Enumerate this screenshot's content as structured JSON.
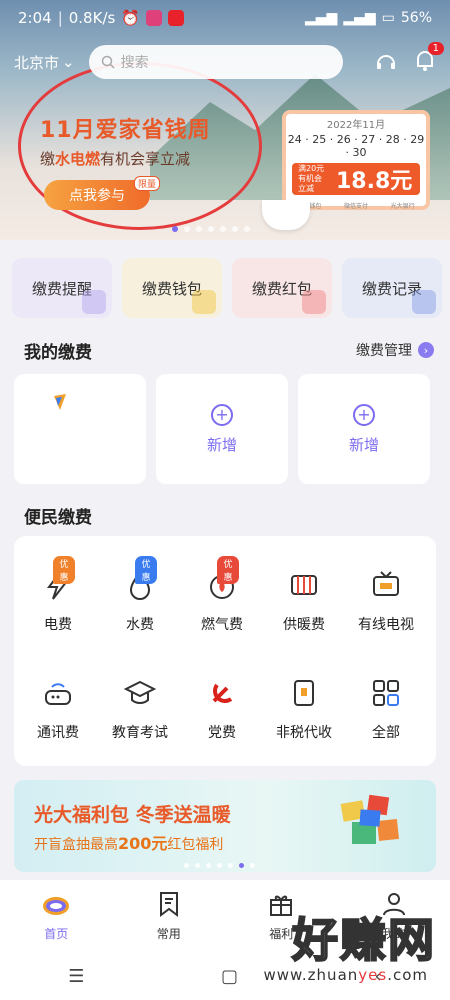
{
  "status": {
    "time": "2:04",
    "speed": "0.8K/s",
    "battery": "56%"
  },
  "header": {
    "city": "北京市",
    "search_placeholder": "搜索",
    "notif_count": "1"
  },
  "hero": {
    "title": "11月爱家省钱周",
    "sub_prefix": "缴",
    "sub_hl": "水电燃",
    "sub_suffix": "有机会享立减",
    "join": "点我参与",
    "limited": "限量",
    "card_date": "2022年11月",
    "card_days": "24 · 25 · 26 · 27 · 28 · 29 · 30",
    "card_small": "满20元 有机会 立减",
    "card_amount": "18.8元",
    "card_foot": [
      "缴费钱包",
      "微信支付",
      "光大银行"
    ]
  },
  "quick": [
    {
      "label": "缴费提醒",
      "bg": "#ece8f7",
      "deco": "#b6a8f0"
    },
    {
      "label": "缴费钱包",
      "bg": "#f6f0dc",
      "deco": "#f2c84a"
    },
    {
      "label": "缴费红包",
      "bg": "#f8e5e5",
      "deco": "#f08888"
    },
    {
      "label": "缴费记录",
      "bg": "#e6eaf6",
      "deco": "#8aa0e6"
    }
  ],
  "my_pay": {
    "title": "我的缴费",
    "manage": "缴费管理",
    "add": "新增"
  },
  "convenience": {
    "title": "便民缴费",
    "items": [
      {
        "label": "电费",
        "tag": "优惠",
        "tagc": "#f0802a"
      },
      {
        "label": "水费",
        "tag": "优惠",
        "tagc": "#3a7cf0"
      },
      {
        "label": "燃气费",
        "tag": "优惠",
        "tagc": "#e84a3a"
      },
      {
        "label": "供暖费",
        "tag": "",
        "tagc": ""
      },
      {
        "label": "有线电视",
        "tag": "",
        "tagc": ""
      },
      {
        "label": "通讯费",
        "tag": "",
        "tagc": ""
      },
      {
        "label": "教育考试",
        "tag": "",
        "tagc": ""
      },
      {
        "label": "党费",
        "tag": "",
        "tagc": ""
      },
      {
        "label": "非税代收",
        "tag": "",
        "tagc": ""
      },
      {
        "label": "全部",
        "tag": "",
        "tagc": ""
      }
    ]
  },
  "banner": {
    "title": "光大福利包 冬季送温暖",
    "sub1": "开盲盒抽最高",
    "sub_hl": "200元",
    "sub2": "红包福利"
  },
  "tabs": [
    {
      "label": "首页"
    },
    {
      "label": "常用"
    },
    {
      "label": "福利"
    },
    {
      "label": "我的"
    }
  ],
  "watermark": {
    "big": "好赚网",
    "small1": "www.zhuan",
    "small2": "yes",
    "small3": ".com"
  }
}
